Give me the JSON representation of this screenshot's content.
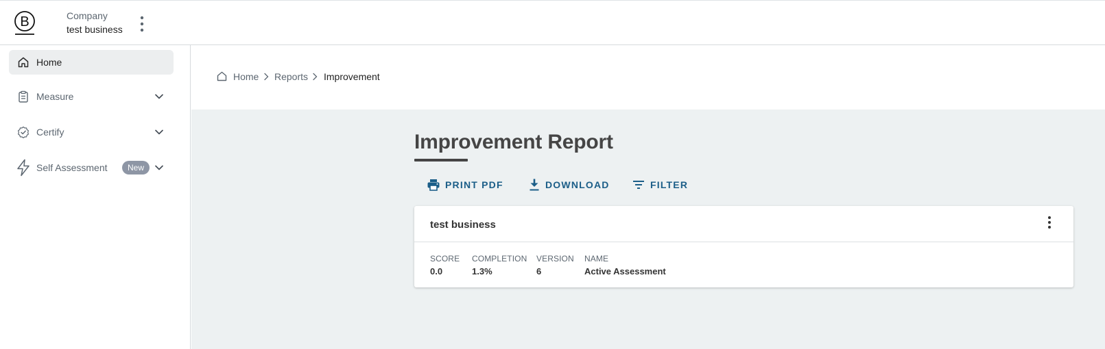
{
  "header": {
    "company_label": "Company",
    "company_name": "test business",
    "logo_icon": "b-corp-logo-icon",
    "menu_icon": "kebab-menu-icon"
  },
  "sidebar": {
    "items": [
      {
        "label": "Home",
        "icon": "home-icon",
        "active": true
      },
      {
        "label": "Measure",
        "icon": "clipboard-icon",
        "expandable": true
      },
      {
        "label": "Certify",
        "icon": "badge-check-icon",
        "expandable": true
      },
      {
        "label": "Self Assessment",
        "icon": "lightning-icon",
        "expandable": true,
        "badge": "New"
      }
    ]
  },
  "breadcrumb": {
    "items": [
      "Home",
      "Reports",
      "Improvement"
    ]
  },
  "page": {
    "title": "Improvement Report",
    "actions": {
      "print": "PRINT PDF",
      "download": "DOWNLOAD",
      "filter": "FILTER"
    }
  },
  "card": {
    "title": "test business",
    "stats": [
      {
        "label": "SCORE",
        "value": "0.0"
      },
      {
        "label": "COMPLETION",
        "value": "1.3%"
      },
      {
        "label": "VERSION",
        "value": "6"
      },
      {
        "label": "NAME",
        "value": "Active Assessment"
      }
    ]
  },
  "colors": {
    "accent": "#1b5e88",
    "main_background": "#edf1f2",
    "badge": "#8e96a5"
  }
}
